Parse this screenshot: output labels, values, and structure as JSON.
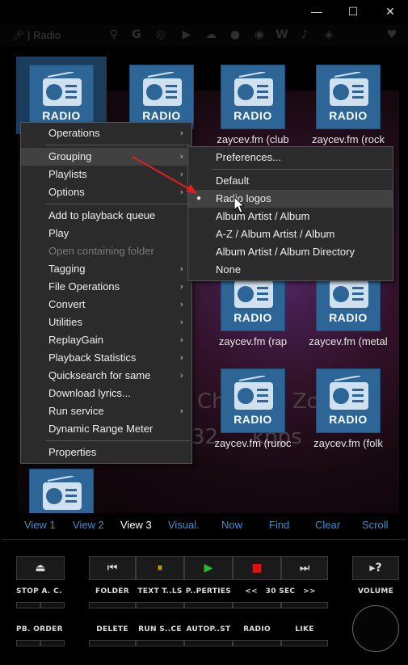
{
  "window": {
    "minimize_glyph": "—",
    "maximize_glyph": "☐",
    "close_glyph": "✕"
  },
  "toolbar": {
    "search_text": "| Radio"
  },
  "tiles": [
    {
      "label": "",
      "art_text": "RADIO"
    },
    {
      "label": "",
      "art_text": "RADIO"
    },
    {
      "label": "zaycev.fm (club",
      "art_text": "RADIO"
    },
    {
      "label": "zaycev.fm (rock",
      "art_text": "RADIO"
    },
    {
      "label": "zaycev.fm (rap",
      "art_text": "RADIO"
    },
    {
      "label": "zaycev.fm (metal",
      "art_text": "RADIO"
    },
    {
      "label": "zaycev.fm (ruroc",
      "art_text": "RADIO"
    },
    {
      "label": "zaycev.fm (folk",
      "art_text": "RADIO"
    },
    {
      "label": "",
      "art_text": ""
    }
  ],
  "background_text": {
    "line1": "Ch",
    "line2": "Zo",
    "line3": "32",
    "line4": "kbps"
  },
  "context_menu": {
    "items": [
      {
        "label": "Operations",
        "submenu": true
      },
      {
        "label": "Grouping",
        "submenu": true
      },
      {
        "label": "Playlists",
        "submenu": true
      },
      {
        "label": "Options",
        "submenu": true
      },
      {
        "label": "Add to playback queue"
      },
      {
        "label": "Play"
      },
      {
        "label": "Open containing folder"
      },
      {
        "label": "Tagging",
        "submenu": true
      },
      {
        "label": "File Operations",
        "submenu": true
      },
      {
        "label": "Convert",
        "submenu": true
      },
      {
        "label": "Utilities",
        "submenu": true
      },
      {
        "label": "ReplayGain",
        "submenu": true
      },
      {
        "label": "Playback Statistics",
        "submenu": true
      },
      {
        "label": "Quicksearch for same",
        "submenu": true
      },
      {
        "label": "Download lyrics..."
      },
      {
        "label": "Run service",
        "submenu": true
      },
      {
        "label": "Dynamic Range Meter"
      },
      {
        "label": "Properties"
      }
    ],
    "arrow_glyph": "›"
  },
  "grouping_submenu": {
    "items": [
      {
        "label": "Preferences..."
      },
      {
        "label": "Default"
      },
      {
        "label": "Radio logos",
        "selected": true
      },
      {
        "label": "Album Artist / Album"
      },
      {
        "label": "A-Z / Album Artist / Album"
      },
      {
        "label": "Album Artist / Album Directory"
      },
      {
        "label": "None"
      }
    ],
    "bullet_glyph": "●"
  },
  "tabs": [
    {
      "label": "View 1"
    },
    {
      "label": "View 2"
    },
    {
      "label": "View 3",
      "active": true
    },
    {
      "label": "Visual."
    },
    {
      "label": "Now"
    },
    {
      "label": "Find"
    },
    {
      "label": "Clear"
    },
    {
      "label": "Scroll"
    }
  ],
  "controls": {
    "eject_glyph": "⏏",
    "prev_glyph": "⏮",
    "pause_glyph": "⏸",
    "play_glyph": "▶",
    "stop_glyph": "■",
    "next_glyph": "⏭",
    "help_glyph": "▸?",
    "labels": {
      "stop_ac": "STOP A. C.",
      "folder": "FOLDER",
      "text_tools": "TEXT T..LS",
      "properties": "P..PERTIES",
      "prev_sec": "<<",
      "sec30": "30 SEC",
      "next_sec": ">>",
      "volume": "VOLUME",
      "pb_order": "PB. ORDER",
      "delete": "DELETE",
      "run_service": "RUN S..CE",
      "autoplaylist": "AUTOP..ST",
      "radio": "RADIO",
      "like": "LIKE"
    }
  },
  "colors": {
    "accent": "#3b8fd6",
    "tile_bg": "#2c6596",
    "pause": "#e8c400",
    "play": "#22c02a",
    "stop": "#e01010"
  }
}
